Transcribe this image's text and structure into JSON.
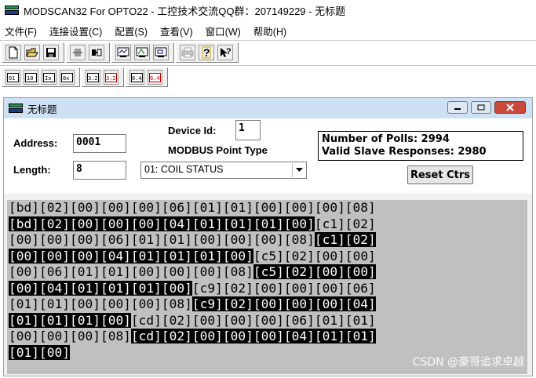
{
  "app": {
    "title": "MODSCAN32 For OPTO22 - 工控技术交流QQ群：207149229 - 无标题"
  },
  "menu": [
    {
      "label": "文件(F)"
    },
    {
      "label": "连接设置(C)"
    },
    {
      "label": "配置(S)"
    },
    {
      "label": "查看(V)"
    },
    {
      "label": "窗口(W)"
    },
    {
      "label": "帮助(H)"
    }
  ],
  "toolbar1": [
    "new-file-icon",
    "open-folder-icon",
    "save-icon",
    "connect-icon",
    "disconnect-icon",
    "display-options-icon",
    "display-options-2-icon",
    "display-options-3-icon",
    "print-icon",
    "help-icon",
    "context-help-icon"
  ],
  "toolbar2": [
    {
      "icon": "coil-status-icon",
      "label": "01"
    },
    {
      "icon": "input-status-icon",
      "label": "10"
    },
    {
      "icon": "input-register-icon",
      "label": "Io"
    },
    {
      "icon": "holding-register-icon",
      "label": "0x"
    },
    {
      "icon": "write-single-icon",
      "label": "3.2"
    },
    {
      "icon": "write-multiple-icon",
      "label": "3.2"
    },
    {
      "icon": "write-coil-icon",
      "label": "6.4"
    },
    {
      "icon": "write-coils-icon",
      "label": "6.4"
    }
  ],
  "child": {
    "title": "无标题",
    "address_label": "Address:",
    "address_value": "0001",
    "length_label": "Length:",
    "length_value": "8",
    "device_id_label": "Device Id:",
    "device_id_value": "1",
    "point_type_label": "MODBUS Point Type",
    "point_type_value": "01: COIL STATUS",
    "polls_text": "Number of Polls: 2994",
    "responses_text": "Valid Slave Responses: 2980",
    "reset_label": "Reset Ctrs"
  },
  "data_lines": [
    [
      {
        "t": "[bd][02][00][00][00][06][01][01][00][00][00][08]",
        "k": "tx"
      }
    ],
    [
      {
        "t": "[bd][02][00][00][00][04][01][01][01][00]",
        "k": "rx"
      },
      {
        "t": "[c1][02]",
        "k": "tx"
      }
    ],
    [
      {
        "t": "[00][00][00][06][01][01][00][00][00][08]",
        "k": "tx"
      },
      {
        "t": "[c1][02]",
        "k": "rx"
      }
    ],
    [
      {
        "t": "[00][00][00][04][01][01][01][00]",
        "k": "rx"
      },
      {
        "t": "[c5][02][00][00]",
        "k": "tx"
      }
    ],
    [
      {
        "t": "[00][06][01][01][00][00][00][08]",
        "k": "tx"
      },
      {
        "t": "[c5][02][00][00]",
        "k": "rx"
      }
    ],
    [
      {
        "t": "[00][04][01][01][01][00]",
        "k": "rx"
      },
      {
        "t": "[c9][02][00][00][00][06]",
        "k": "tx"
      }
    ],
    [
      {
        "t": "[01][01][00][00][00][08]",
        "k": "tx"
      },
      {
        "t": "[c9][02][00][00][00][04]",
        "k": "rx"
      }
    ],
    [
      {
        "t": "[01][01][01][00]",
        "k": "rx"
      },
      {
        "t": "[cd][02][00][00][00][06][01][01]",
        "k": "tx"
      }
    ],
    [
      {
        "t": "[00][00][00][08]",
        "k": "tx"
      },
      {
        "t": "[cd][02][00][00][00][04][01][01]",
        "k": "rx"
      }
    ],
    [
      {
        "t": "[01][00]",
        "k": "rx"
      }
    ]
  ],
  "watermark": "CSDN @豪哥追求卓越"
}
